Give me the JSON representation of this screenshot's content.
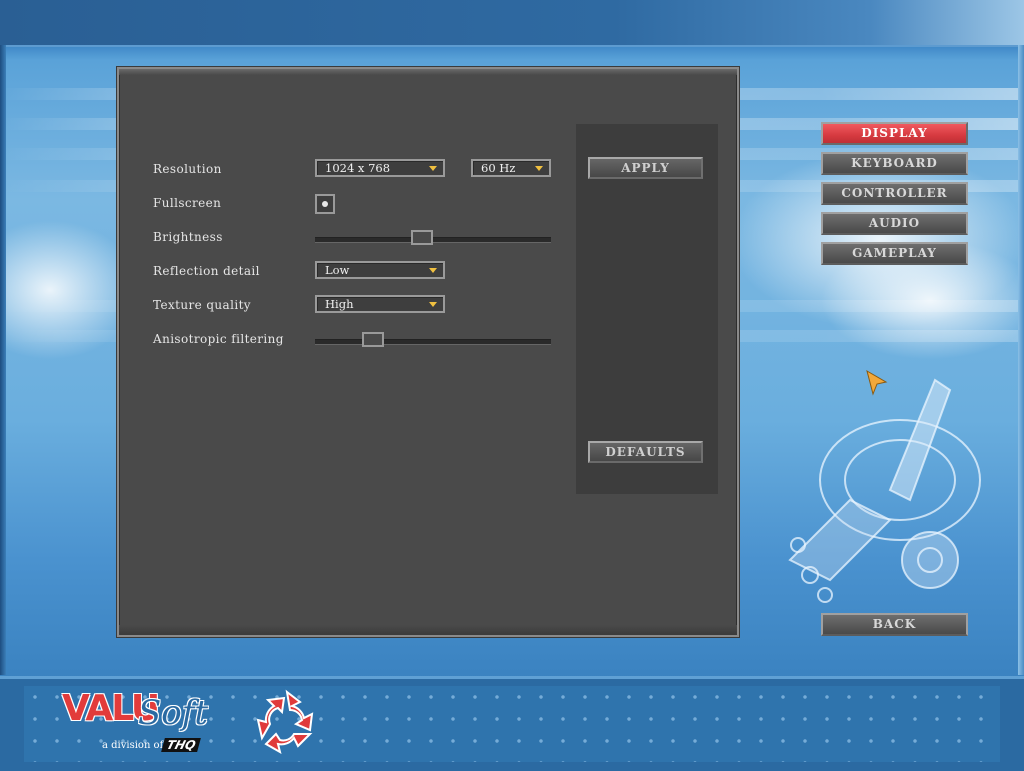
{
  "settings": {
    "resolution": {
      "label": "Resolution",
      "value": "1024 x 768",
      "refresh": "60 Hz"
    },
    "fullscreen": {
      "label": "Fullscreen",
      "checked": true
    },
    "brightness": {
      "label": "Brightness",
      "level_fraction": 0.45
    },
    "reflection_detail": {
      "label": "Reflection detail",
      "value": "Low"
    },
    "texture_quality": {
      "label": "Texture quality",
      "value": "High"
    },
    "anisotropic_filtering": {
      "label": "Anisotropic filtering",
      "level_fraction": 0.22
    }
  },
  "actions": {
    "apply": "APPLY",
    "defaults": "DEFAULTS",
    "back": "BACK"
  },
  "nav": {
    "items": [
      {
        "label": "DISPLAY",
        "active": true
      },
      {
        "label": "KEYBOARD",
        "active": false
      },
      {
        "label": "CONTROLLER",
        "active": false
      },
      {
        "label": "AUDIO",
        "active": false
      },
      {
        "label": "GAMEPLAY",
        "active": false
      }
    ]
  },
  "branding": {
    "valu": "VALU",
    "soft": "Soft",
    "division": "a division of",
    "thq": "THQ"
  },
  "colors": {
    "active_nav": "#d63a40",
    "dropdown_arrow": "#f0c040",
    "panel": "#4a4a4a"
  },
  "icons": {
    "pointer": "arrow-cursor-icon",
    "dropdown": "chevron-down-icon",
    "logo": "swirl-logo-icon"
  }
}
